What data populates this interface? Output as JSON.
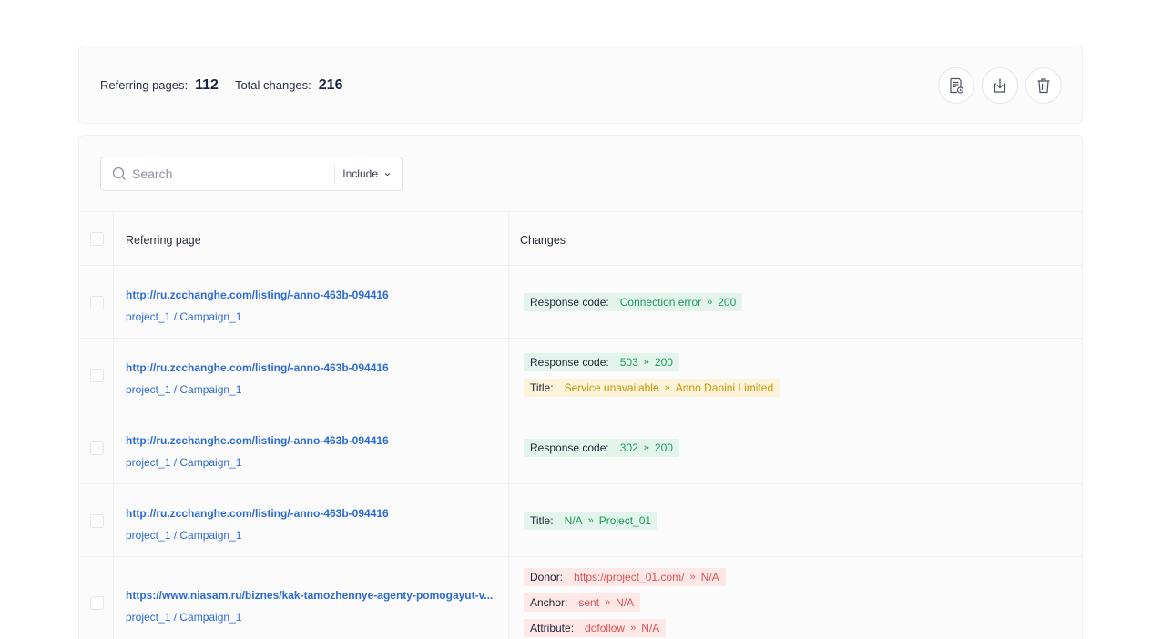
{
  "summary": {
    "referring_pages_label": "Referring pages:",
    "referring_pages_value": "112",
    "total_changes_label": "Total changes:",
    "total_changes_value": "216",
    "actions": [
      "report-icon",
      "download-icon",
      "trash-icon"
    ]
  },
  "search": {
    "placeholder": "Search",
    "filter_label": "Include"
  },
  "table": {
    "headers": {
      "page": "Referring page",
      "changes": "Changes"
    },
    "rows": [
      {
        "url": "http://ru.zcchanghe.com/listing/-anno-463b-094416",
        "project": "project_1 / Campaign_1",
        "changes": [
          {
            "key": "Response code:",
            "from": "Connection error",
            "arrow": "»",
            "to": "200",
            "color": "green"
          }
        ]
      },
      {
        "url": "http://ru.zcchanghe.com/listing/-anno-463b-094416",
        "project": "project_1 / Campaign_1",
        "changes": [
          {
            "key": "Response code:",
            "from": "503",
            "arrow": "»",
            "to": "200",
            "color": "green"
          },
          {
            "key": "Title:",
            "from": "Service unavailable",
            "arrow": "»",
            "to": "Anno Danini Limited",
            "color": "yellow"
          }
        ]
      },
      {
        "url": "http://ru.zcchanghe.com/listing/-anno-463b-094416",
        "project": "project_1 / Campaign_1",
        "changes": [
          {
            "key": "Response code:",
            "from": "302",
            "arrow": "»",
            "to": "200",
            "color": "green"
          }
        ]
      },
      {
        "url": "http://ru.zcchanghe.com/listing/-anno-463b-094416",
        "project": "project_1 / Campaign_1",
        "changes": [
          {
            "key": "Title:",
            "from": "N/A",
            "arrow": "»",
            "to": "Project_01",
            "color": "green"
          }
        ]
      },
      {
        "url": "https://www.niasam.ru/biznes/kak-tamozhennye-agenty-pomogayut-v...",
        "project": "project_1 / Campaign_1",
        "changes": [
          {
            "key": "Donor:",
            "from": "https://project_01.com/",
            "arrow": "»",
            "to": "N/A",
            "color": "red"
          },
          {
            "key": "Anchor:",
            "from": "sent",
            "arrow": "»",
            "to": "N/A",
            "color": "red"
          },
          {
            "key": "Attribute:",
            "from": "dofollow",
            "arrow": "»",
            "to": "N/A",
            "color": "red"
          }
        ]
      }
    ]
  }
}
